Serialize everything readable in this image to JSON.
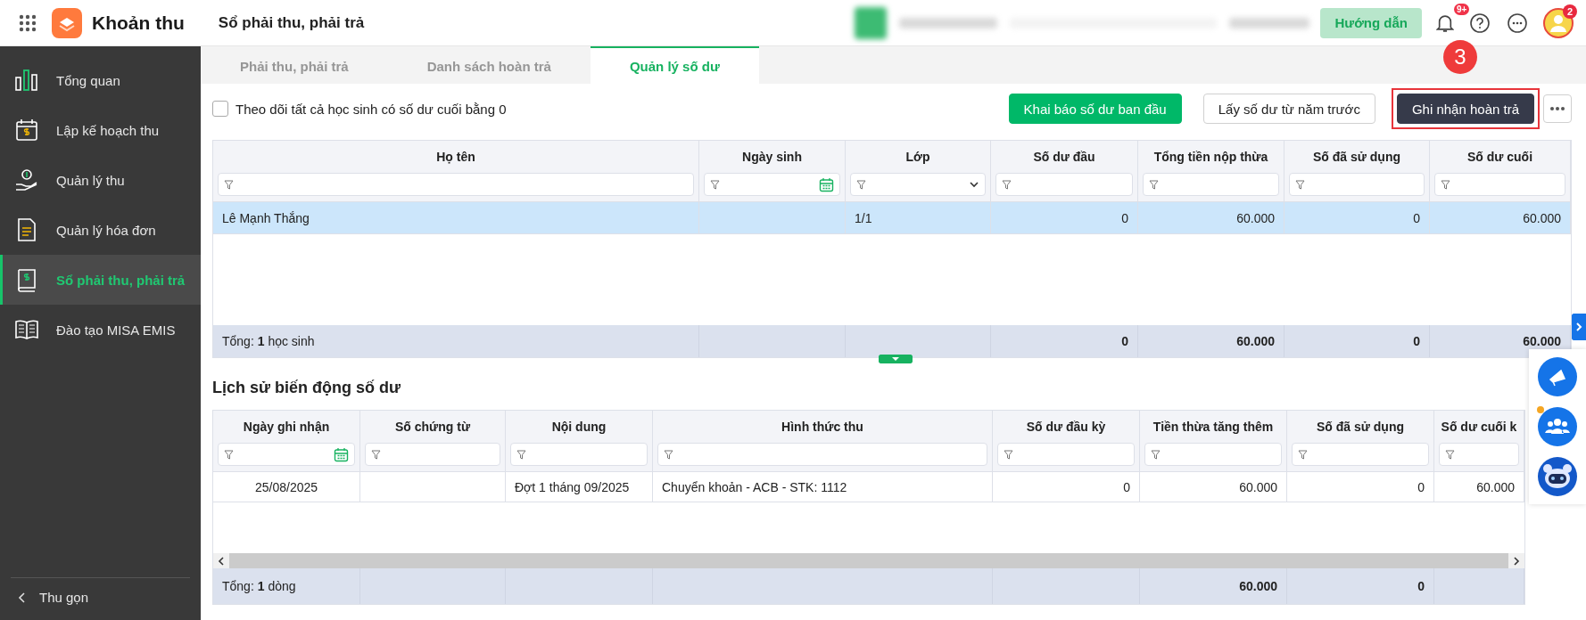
{
  "app": {
    "name": "Khoản thu",
    "page_title": "Sổ phải thu, phải trả"
  },
  "header": {
    "help_button": "Hướng dẫn",
    "notification_badge": "9+",
    "avatar_badge": "2"
  },
  "sidebar": {
    "items": [
      {
        "label": "Tổng quan",
        "kind": "chart",
        "selected": false
      },
      {
        "label": "Lập kế hoạch thu",
        "kind": "calendar",
        "selected": false
      },
      {
        "label": "Quản lý thu",
        "kind": "hand",
        "selected": false
      },
      {
        "label": "Quản lý hóa đơn",
        "kind": "document",
        "selected": false
      },
      {
        "label": "Sổ phải thu, phải trả",
        "kind": "ledger",
        "selected": true
      },
      {
        "label": "Đào tạo MISA EMIS",
        "kind": "book",
        "selected": false
      }
    ],
    "collapse": "Thu gọn"
  },
  "tabs": [
    {
      "label": "Phải thu, phải trả",
      "selected": false
    },
    {
      "label": "Danh sách hoàn trả",
      "selected": false
    },
    {
      "label": "Quản lý số dư",
      "selected": true
    }
  ],
  "toolbar": {
    "checkbox": {
      "label": "Theo dõi tất cả học sinh có số dư cuối bằng 0",
      "checked": false
    },
    "buttons": [
      {
        "label": "Khai báo số dư ban đầu",
        "kind": "primary",
        "highlighted": false
      },
      {
        "label": "Lấy số dư từ năm trước",
        "kind": "secondary",
        "highlighted": false
      },
      {
        "label": "Ghi nhận hoàn trả",
        "kind": "dark",
        "highlighted": true,
        "step": "3"
      }
    ]
  },
  "balance_table": {
    "columns": [
      {
        "label": "Họ tên",
        "kind": "text"
      },
      {
        "label": "Ngày sinh",
        "kind": "date"
      },
      {
        "label": "Lớp",
        "kind": "select"
      },
      {
        "label": "Số dư đầu",
        "kind": "number"
      },
      {
        "label": "Tổng tiền nộp thừa",
        "kind": "number"
      },
      {
        "label": "Số đã sử dụng",
        "kind": "number"
      },
      {
        "label": "Số dư cuối",
        "kind": "number"
      }
    ],
    "rows": [
      {
        "cells": [
          "Lê Mạnh Thắng",
          null,
          "1/1",
          "0",
          "60.000",
          "0",
          "60.000"
        ],
        "selected": true
      }
    ],
    "summary": [
      {
        "kind": "label",
        "text": "Tổng: **1** học sinh"
      },
      {
        "kind": "blank"
      },
      {
        "kind": "blank"
      },
      {
        "kind": "total",
        "text": "0"
      },
      {
        "kind": "total",
        "text": "60.000"
      },
      {
        "kind": "total",
        "text": "0"
      },
      {
        "kind": "total",
        "text": "60.000"
      }
    ]
  },
  "history": {
    "title": "Lịch sử biến động số dư",
    "columns": [
      {
        "label": "Ngày ghi nhận",
        "kind": "date"
      },
      {
        "label": "Số chứng từ",
        "kind": "text"
      },
      {
        "label": "Nội dung",
        "kind": "text"
      },
      {
        "label": "Hình thức thu",
        "kind": "text"
      },
      {
        "label": "Số dư đầu kỳ",
        "kind": "number"
      },
      {
        "label": "Tiền thừa tăng thêm",
        "kind": "number"
      },
      {
        "label": "Số đã sử dụng",
        "kind": "number"
      },
      {
        "label": "Số dư cuối k",
        "kind": "number"
      }
    ],
    "rows": [
      {
        "cells": [
          "25/08/2025",
          null,
          "Đợt 1 tháng 09/2025",
          "Chuyển khoản - ACB - STK: 1112",
          "0",
          "60.000",
          "0",
          "60.000"
        ],
        "selected": false
      }
    ],
    "summary": [
      {
        "kind": "label",
        "text": "Tổng: **1** dòng"
      },
      {
        "kind": "blank"
      },
      {
        "kind": "blank"
      },
      {
        "kind": "blank"
      },
      {
        "kind": "blank"
      },
      {
        "kind": "total",
        "text": "60.000"
      },
      {
        "kind": "total",
        "text": "0"
      },
      {
        "kind": "blank"
      }
    ]
  }
}
